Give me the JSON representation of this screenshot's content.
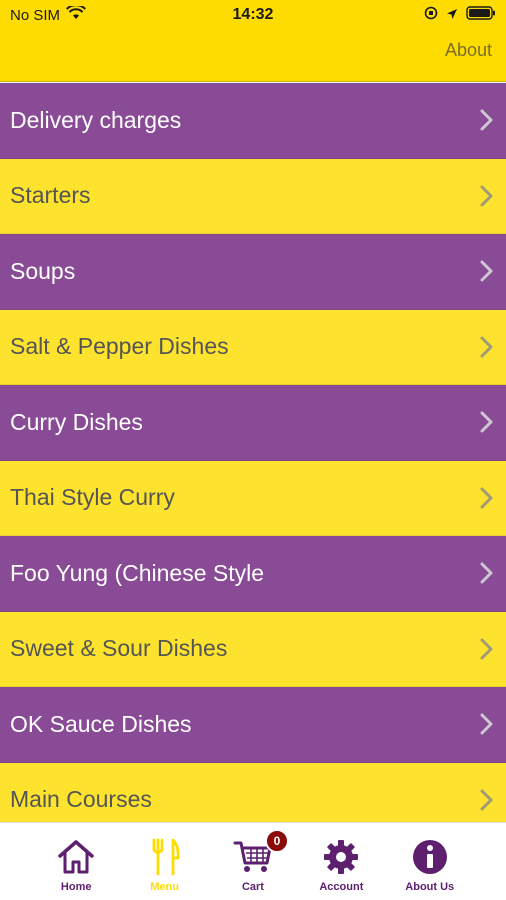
{
  "status_bar": {
    "carrier": "No SIM",
    "time": "14:32"
  },
  "nav": {
    "about_label": "About"
  },
  "menu": {
    "items": [
      {
        "label": "Delivery charges"
      },
      {
        "label": "Starters"
      },
      {
        "label": "Soups"
      },
      {
        "label": "Salt & Pepper Dishes"
      },
      {
        "label": "Curry Dishes"
      },
      {
        "label": "Thai Style Curry"
      },
      {
        "label": "Foo Yung (Chinese Style"
      },
      {
        "label": "Sweet & Sour Dishes"
      },
      {
        "label": "OK Sauce Dishes"
      },
      {
        "label": "Main Courses"
      }
    ]
  },
  "tabs": {
    "home": "Home",
    "menu": "Menu",
    "cart": "Cart",
    "cart_badge": "0",
    "account": "Account",
    "about_us": "About Us"
  },
  "colors": {
    "brand_yellow": "#FFDC00",
    "row_purple": "#8A4B96",
    "row_yellow": "#FDE32E",
    "tab_purple": "#5d1f6e",
    "badge_red": "#8b0a0a"
  }
}
